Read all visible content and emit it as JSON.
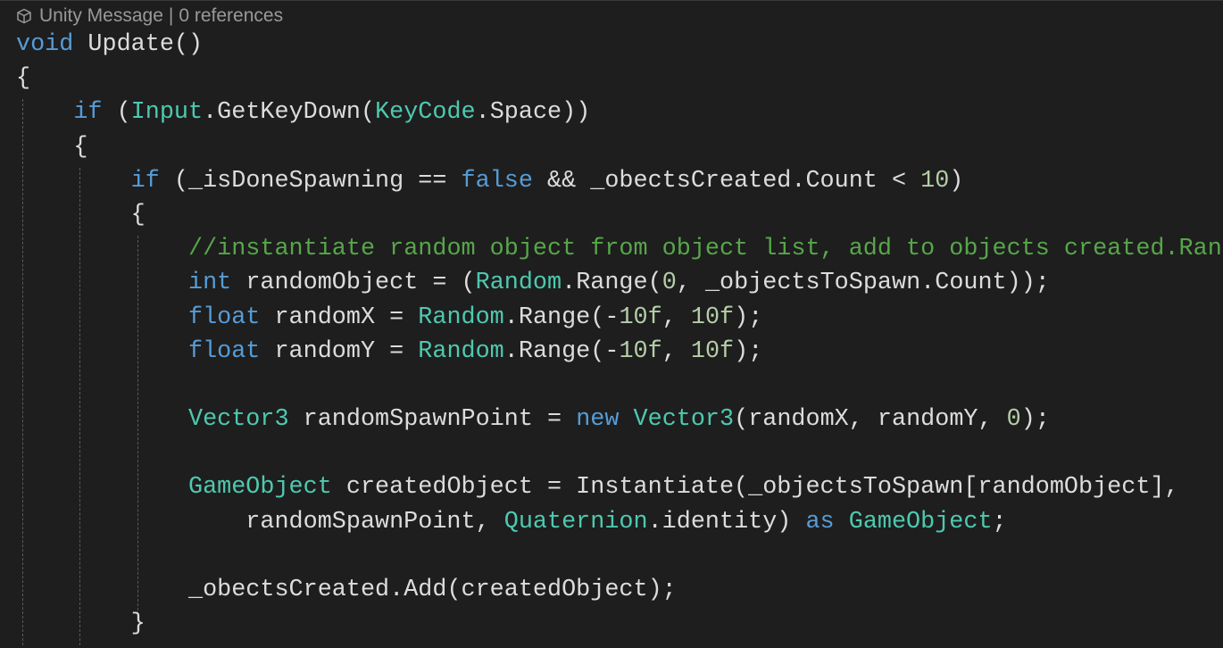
{
  "codelens": {
    "icon": "unity-cube-icon",
    "kind": "Unity Message",
    "separator": "|",
    "references": "0 references"
  },
  "theme": {
    "background": "#1e1e1e",
    "keyword": "#569cd6",
    "type": "#4ec9b0",
    "comment": "#57a64a",
    "number": "#b5cea8",
    "text": "#dcdcdc",
    "codelens": "#999999"
  },
  "lines": [
    {
      "indent": 0,
      "tokens": [
        [
          "kw",
          "void"
        ],
        [
          "pl",
          " Update()"
        ]
      ]
    },
    {
      "indent": 0,
      "tokens": [
        [
          "pl",
          "{"
        ]
      ]
    },
    {
      "indent": 1,
      "tokens": [
        [
          "kw",
          "if"
        ],
        [
          "pl",
          " ("
        ],
        [
          "ty",
          "Input"
        ],
        [
          "pl",
          ".GetKeyDown("
        ],
        [
          "ty",
          "KeyCode"
        ],
        [
          "pl",
          ".Space))"
        ]
      ]
    },
    {
      "indent": 1,
      "tokens": [
        [
          "pl",
          "{"
        ]
      ]
    },
    {
      "indent": 2,
      "tokens": [
        [
          "kw",
          "if"
        ],
        [
          "pl",
          " (_isDoneSpawning == "
        ],
        [
          "kw",
          "false"
        ],
        [
          "pl",
          " && _obectsCreated.Count < "
        ],
        [
          "num",
          "10"
        ],
        [
          "pl",
          ")"
        ]
      ]
    },
    {
      "indent": 2,
      "tokens": [
        [
          "pl",
          "{"
        ]
      ]
    },
    {
      "indent": 3,
      "tokens": [
        [
          "cm",
          "//instantiate random object from object list, add to objects created.Ran"
        ]
      ]
    },
    {
      "indent": 3,
      "tokens": [
        [
          "kw",
          "int"
        ],
        [
          "pl",
          " randomObject = ("
        ],
        [
          "ty",
          "Random"
        ],
        [
          "pl",
          ".Range("
        ],
        [
          "num",
          "0"
        ],
        [
          "pl",
          ", _objectsToSpawn.Count));"
        ]
      ]
    },
    {
      "indent": 3,
      "tokens": [
        [
          "kw",
          "float"
        ],
        [
          "pl",
          " randomX = "
        ],
        [
          "ty",
          "Random"
        ],
        [
          "pl",
          ".Range(-"
        ],
        [
          "num",
          "10f"
        ],
        [
          "pl",
          ", "
        ],
        [
          "num",
          "10f"
        ],
        [
          "pl",
          ");"
        ]
      ]
    },
    {
      "indent": 3,
      "tokens": [
        [
          "kw",
          "float"
        ],
        [
          "pl",
          " randomY = "
        ],
        [
          "ty",
          "Random"
        ],
        [
          "pl",
          ".Range(-"
        ],
        [
          "num",
          "10f"
        ],
        [
          "pl",
          ", "
        ],
        [
          "num",
          "10f"
        ],
        [
          "pl",
          ");"
        ]
      ]
    },
    {
      "indent": 3,
      "tokens": []
    },
    {
      "indent": 3,
      "tokens": [
        [
          "ty",
          "Vector3"
        ],
        [
          "pl",
          " randomSpawnPoint = "
        ],
        [
          "kw",
          "new"
        ],
        [
          "pl",
          " "
        ],
        [
          "ty",
          "Vector3"
        ],
        [
          "pl",
          "(randomX, randomY, "
        ],
        [
          "num",
          "0"
        ],
        [
          "pl",
          ");"
        ]
      ]
    },
    {
      "indent": 3,
      "tokens": []
    },
    {
      "indent": 3,
      "tokens": [
        [
          "ty",
          "GameObject"
        ],
        [
          "pl",
          " createdObject = Instantiate(_objectsToSpawn[randomObject],"
        ]
      ]
    },
    {
      "indent": 4,
      "tokens": [
        [
          "pl",
          "randomSpawnPoint, "
        ],
        [
          "ty",
          "Quaternion"
        ],
        [
          "pl",
          ".identity) "
        ],
        [
          "kw",
          "as"
        ],
        [
          "pl",
          " "
        ],
        [
          "ty",
          "GameObject"
        ],
        [
          "pl",
          ";"
        ]
      ]
    },
    {
      "indent": 3,
      "tokens": []
    },
    {
      "indent": 3,
      "tokens": [
        [
          "pl",
          "_obectsCreated.Add(createdObject);"
        ]
      ]
    },
    {
      "indent": 2,
      "tokens": [
        [
          "pl",
          "}"
        ]
      ]
    }
  ]
}
